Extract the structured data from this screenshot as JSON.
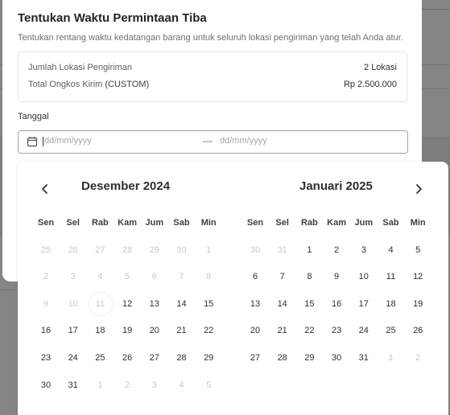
{
  "modal": {
    "title": "Tentukan Waktu Permintaan Tiba",
    "description": "Tentukan rentang waktu kedatangan barang untuk seluruh lokasi pengiriman yang telah Anda atur.",
    "summary": {
      "locations_label": "Jumlah Lokasi Pengiriman",
      "locations_value": "2 Lokasi",
      "shipping_label": "Total Ongkos Kirim",
      "shipping_label_suffix": "(CUSTOM)",
      "shipping_value": "Rp 2.500.000"
    },
    "date_field": {
      "label": "Tanggal",
      "start_placeholder": "dd/mm/yyyy",
      "separator": "—",
      "end_placeholder": "dd/mm/yyyy"
    }
  },
  "picker": {
    "weekdays": [
      "Sen",
      "Sel",
      "Rab",
      "Kam",
      "Jum",
      "Sab",
      "Min"
    ],
    "months": [
      {
        "title": "Desember 2024",
        "days": [
          [
            "25",
            "26",
            "27",
            "28",
            "29",
            "30",
            "1"
          ],
          [
            "2",
            "3",
            "4",
            "5",
            "6",
            "7",
            "8"
          ],
          [
            "9",
            "10",
            "11",
            "12",
            "13",
            "14",
            "15"
          ],
          [
            "16",
            "17",
            "18",
            "19",
            "20",
            "21",
            "22"
          ],
          [
            "23",
            "24",
            "25",
            "26",
            "27",
            "28",
            "29"
          ],
          [
            "30",
            "31",
            "1",
            "2",
            "3",
            "4",
            "5"
          ]
        ],
        "disabled_until": 17,
        "trailing_from": 37,
        "today_index": 16
      },
      {
        "title": "Januari 2025",
        "days": [
          [
            "30",
            "31",
            "1",
            "2",
            "3",
            "4",
            "5"
          ],
          [
            "6",
            "7",
            "8",
            "9",
            "10",
            "11",
            "12"
          ],
          [
            "13",
            "14",
            "15",
            "16",
            "17",
            "18",
            "19"
          ],
          [
            "20",
            "21",
            "22",
            "23",
            "24",
            "25",
            "26"
          ],
          [
            "27",
            "28",
            "29",
            "30",
            "31",
            "1",
            "2"
          ]
        ],
        "disabled_until": 2,
        "trailing_from": 33,
        "today_index": -1
      }
    ]
  }
}
